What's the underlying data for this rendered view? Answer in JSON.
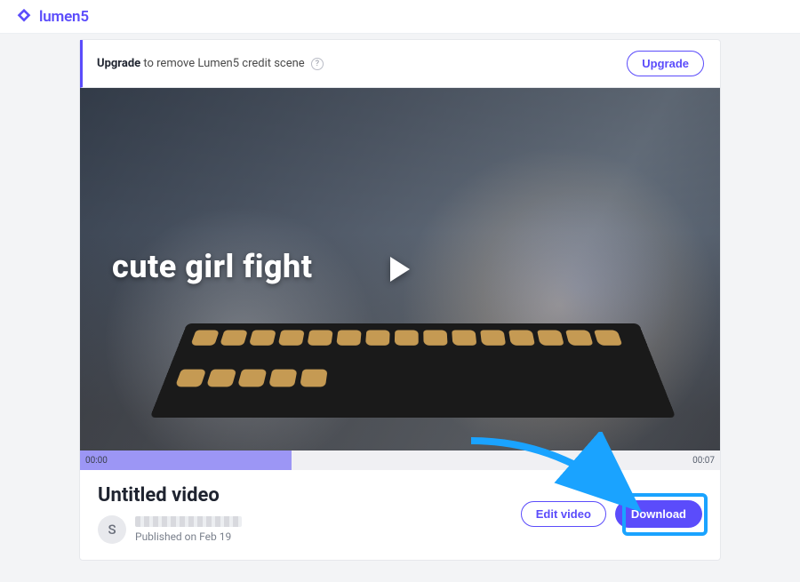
{
  "brand": {
    "name": "lumen5"
  },
  "upgrade_bar": {
    "bold": "Upgrade",
    "rest": " to remove Lumen5 credit scene",
    "button": "Upgrade"
  },
  "video": {
    "overlay_text": "cute girl fight",
    "time_start": "00:00",
    "time_end": "00:07",
    "progress_percent": 33
  },
  "meta": {
    "title": "Untitled video",
    "avatar_initial": "S",
    "published": "Published on Feb 19"
  },
  "actions": {
    "edit": "Edit video",
    "download": "Download"
  }
}
